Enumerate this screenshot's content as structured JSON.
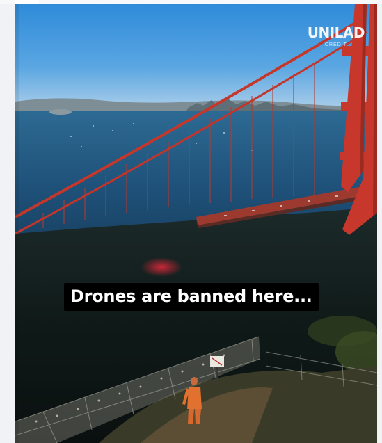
{
  "video": {
    "watermark_brand": "UNILAD",
    "watermark_sub": "CREDIT",
    "caption": "Drones are banned here..."
  },
  "colors": {
    "sky_top": "#2a88d6",
    "bridge_red": "#c5372a",
    "water": "#1f4e72",
    "caption_bg": "#000000",
    "caption_text": "#ffffff"
  }
}
